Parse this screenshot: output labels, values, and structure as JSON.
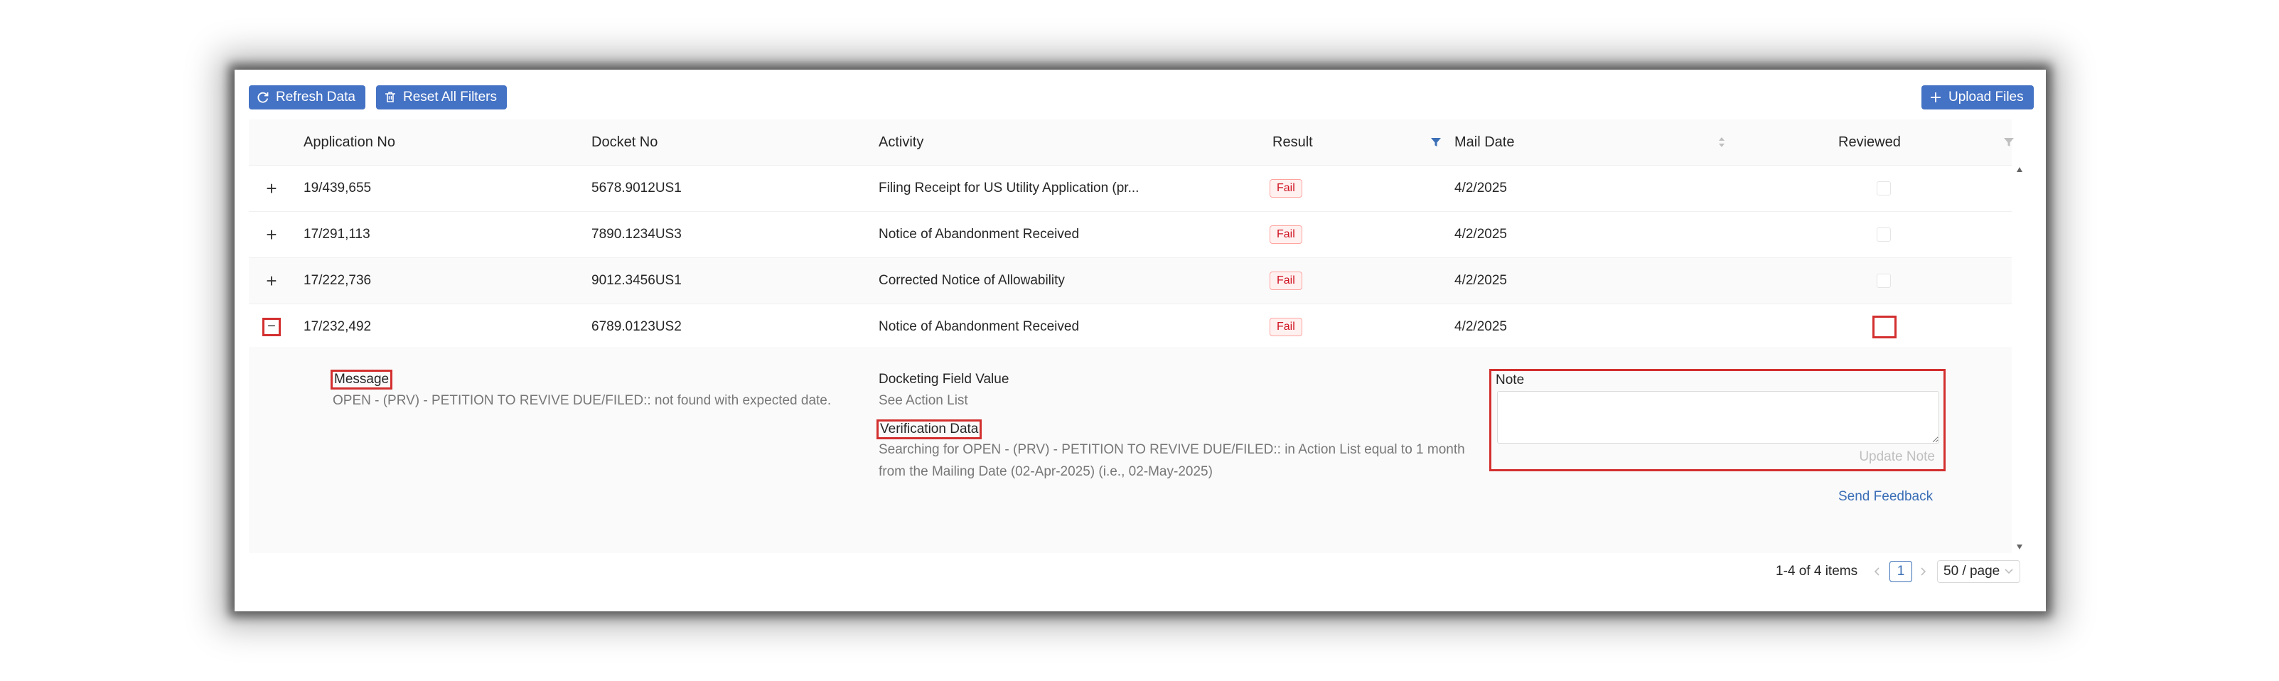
{
  "toolbar": {
    "refresh_label": "Refresh Data",
    "reset_label": "Reset All Filters",
    "upload_label": "Upload Files",
    "refresh_icon": "refresh-icon",
    "reset_icon": "clear-filter-icon",
    "upload_icon": "plus-icon"
  },
  "table": {
    "columns": [
      "Application No",
      "Docket No",
      "Activity",
      "Result",
      "Mail Date",
      "Reviewed"
    ],
    "rows": [
      {
        "expand": "+",
        "app_no": "19/439,655",
        "docket": "5678.9012US1",
        "activity": "Filing Receipt for US Utility Application (pr...",
        "result": "Fail",
        "mail_date": "4/2/2025",
        "reviewed": false
      },
      {
        "expand": "+",
        "app_no": "17/291,113",
        "docket": "7890.1234US3",
        "activity": "Notice of Abandonment Received",
        "result": "Fail",
        "mail_date": "4/2/2025",
        "reviewed": false
      },
      {
        "expand": "+",
        "app_no": "17/222,736",
        "docket": "9012.3456US1",
        "activity": "Corrected Notice of Allowability",
        "result": "Fail",
        "mail_date": "4/2/2025",
        "reviewed": false
      },
      {
        "expand": "−",
        "app_no": "17/232,492",
        "docket": "6789.0123US2",
        "activity": "Notice of Abandonment Received",
        "result": "Fail",
        "mail_date": "4/2/2025",
        "reviewed": false
      }
    ]
  },
  "expanded": {
    "message_label": "Message",
    "message_text": "OPEN - (PRV) - PETITION TO REVIVE DUE/FILED:: not found with expected date.",
    "docketing_label": "Docketing Field Value",
    "docketing_value": "See Action List",
    "verification_label": "Verification Data",
    "verification_line1": "Searching for OPEN - (PRV) - PETITION TO REVIVE DUE/FILED:: in Action List equal to 1 month",
    "verification_line2": "from the Mailing Date (02-Apr-2025) (i.e., 02-May-2025)",
    "note_label": "Note",
    "note_value": "",
    "update_note_label": "Update Note",
    "send_feedback_label": "Send Feedback"
  },
  "pagination": {
    "summary": "1-4 of 4 items",
    "current_page": "1",
    "page_size": "50 / page"
  },
  "colors": {
    "primary": "#4472c4",
    "fail_text": "#cf1322",
    "fail_border": "#ffa39e",
    "fail_bg": "#fff1f0",
    "highlight": "#d32f2f",
    "link": "#3b6fb6"
  }
}
